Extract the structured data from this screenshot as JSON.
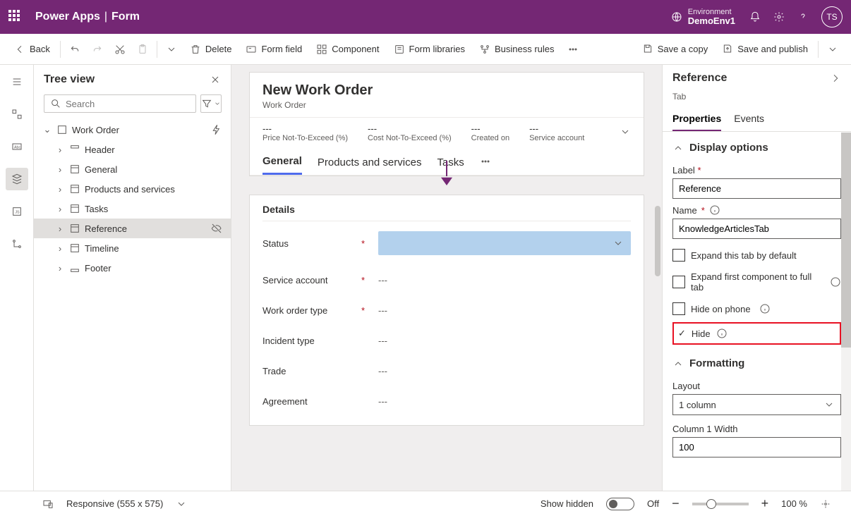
{
  "header": {
    "app_name": "Power Apps",
    "page_type": "Form",
    "env_label": "Environment",
    "env_value": "DemoEnv1",
    "avatar": "TS"
  },
  "cmdbar": {
    "back": "Back",
    "delete": "Delete",
    "form_field": "Form field",
    "component": "Component",
    "form_libraries": "Form libraries",
    "business_rules": "Business rules",
    "save_copy": "Save a copy",
    "save_publish": "Save and publish"
  },
  "tree": {
    "title": "Tree view",
    "search_placeholder": "Search",
    "root": "Work Order",
    "items": [
      {
        "label": "Header"
      },
      {
        "label": "General"
      },
      {
        "label": "Products and services"
      },
      {
        "label": "Tasks"
      },
      {
        "label": "Reference"
      },
      {
        "label": "Timeline"
      },
      {
        "label": "Footer"
      }
    ]
  },
  "form": {
    "title": "New Work Order",
    "subtitle": "Work Order",
    "kpis": [
      {
        "v": "---",
        "l": "Price Not-To-Exceed (%)"
      },
      {
        "v": "---",
        "l": "Cost Not-To-Exceed (%)"
      },
      {
        "v": "---",
        "l": "Created on"
      },
      {
        "v": "---",
        "l": "Service account"
      }
    ],
    "tabs": [
      "General",
      "Products and services",
      "Tasks"
    ],
    "section_title": "Details",
    "fields": [
      {
        "label": "Status",
        "required": true,
        "value": "",
        "select": true
      },
      {
        "label": "Service account",
        "required": true,
        "value": "---"
      },
      {
        "label": "Work order type",
        "required": true,
        "value": "---"
      },
      {
        "label": "Incident type",
        "required": false,
        "value": "---"
      },
      {
        "label": "Trade",
        "required": false,
        "value": "---"
      },
      {
        "label": "Agreement",
        "required": false,
        "value": "---"
      }
    ]
  },
  "props": {
    "title": "Reference",
    "type": "Tab",
    "tabs": [
      "Properties",
      "Events"
    ],
    "section1": "Display options",
    "label_lbl": "Label",
    "label_val": "Reference",
    "name_lbl": "Name",
    "name_val": "KnowledgeArticlesTab",
    "chk_expand": "Expand this tab by default",
    "chk_full": "Expand first component to full tab",
    "chk_hide_phone": "Hide on phone",
    "chk_hide": "Hide",
    "section2": "Formatting",
    "layout_lbl": "Layout",
    "layout_val": "1 column",
    "col1_lbl": "Column 1 Width",
    "col1_val": "100"
  },
  "status": {
    "responsive": "Responsive (555 x 575)",
    "show_hidden": "Show hidden",
    "toggle": "Off",
    "zoom": "100 %"
  }
}
